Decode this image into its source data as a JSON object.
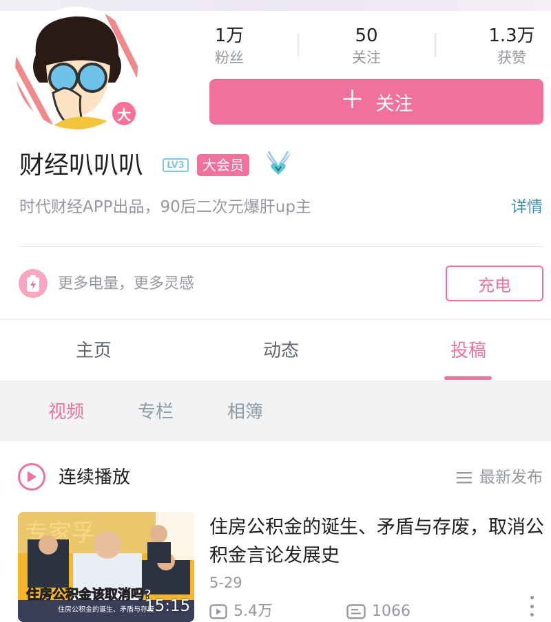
{
  "profile": {
    "avatar_badge": "大",
    "name": "财经叭叭叭",
    "level": "LV3",
    "member_badge": "大会员",
    "bio": "时代财经APP出品，90后二次元爆肝up主",
    "detail_link": "详情",
    "avatar_icon": "cartoon-avatar-with-glasses",
    "pendant_icon": "heart-wings-pendant"
  },
  "stats": [
    {
      "value": "1万",
      "label": "粉丝"
    },
    {
      "value": "50",
      "label": "关注"
    },
    {
      "value": "1.3万",
      "label": "获赞"
    }
  ],
  "follow_button": {
    "plus": "＋",
    "label": "关注"
  },
  "charge": {
    "text": "更多电量，更多灵感",
    "button": "充电",
    "icon": "battery-icon"
  },
  "tabs": [
    {
      "label": "主页",
      "active": false
    },
    {
      "label": "动态",
      "active": false
    },
    {
      "label": "投稿",
      "active": true
    }
  ],
  "subtabs": [
    {
      "label": "视频",
      "active": true
    },
    {
      "label": "专栏",
      "active": false
    },
    {
      "label": "相簿",
      "active": false
    }
  ],
  "playlist": {
    "label": "连续播放",
    "sort_label": "最新发布"
  },
  "videos": [
    {
      "title": "住房公积金的诞生、矛盾与存废，取消公积金言论发展史",
      "date": "5-29",
      "duration": "15:15",
      "views": "5.4万",
      "danmaku": "1066",
      "thumb_caption": "住房公积金该取消吗?",
      "thumb_subcaption": "住房公积金的诞生、矛盾与存废",
      "thumb_bg_text": "专家孚"
    }
  ],
  "colors": {
    "accent": "#f0729a",
    "link": "#3a8fb7",
    "secondary_text": "#9499a0"
  }
}
